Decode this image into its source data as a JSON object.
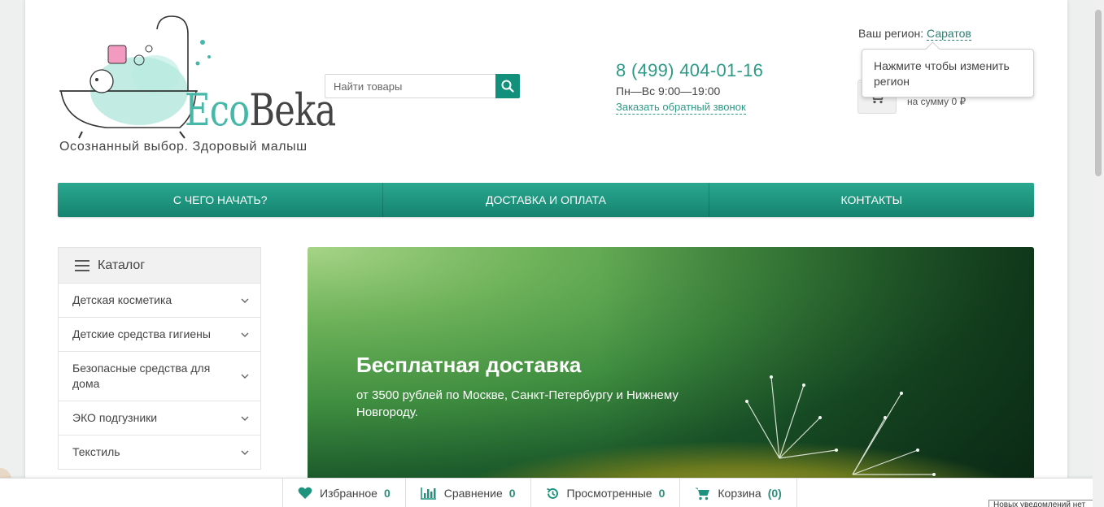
{
  "header": {
    "logo_text_a": "Eco",
    "logo_text_b": "Beka",
    "tagline": "Осознанный выбор. Здоровый малыш",
    "search_placeholder": "Найти товары",
    "phone": "8 (499) 404-01-16",
    "hours": "Пн—Вс 9:00—19:00",
    "callback": "Заказать обратный звонок",
    "region_label": "Ваш регион:",
    "region_city": "Саратов",
    "region_tooltip": "Нажмите чтобы изменить регион",
    "cart_sum": "на сумму 0 ₽"
  },
  "nav": {
    "items": [
      {
        "label": "С чего начать?"
      },
      {
        "label": "Доставка и оплата"
      },
      {
        "label": "Контакты"
      }
    ]
  },
  "catalog": {
    "title": "Каталог",
    "items": [
      {
        "label": "Детская косметика"
      },
      {
        "label": "Детские средства гигиены"
      },
      {
        "label": "Безопасные средства для дома"
      },
      {
        "label": "ЭКО подгузники"
      },
      {
        "label": "Текстиль"
      }
    ]
  },
  "banner": {
    "title": "Бесплатная доставка",
    "subtitle": "от 3500 рублей по Москве, Санкт-Петербургу и Нижнему Новгороду."
  },
  "bottombar": {
    "items": [
      {
        "label": "Избранное",
        "count": "0",
        "icon": "heart-icon"
      },
      {
        "label": "Сравнение",
        "count": "0",
        "icon": "bar-chart-icon"
      },
      {
        "label": "Просмотренные",
        "count": "0",
        "icon": "history-icon"
      },
      {
        "label": "Корзина",
        "count": "(0)",
        "icon": "cart-icon"
      }
    ],
    "notice": "Новых уведомлений нет"
  },
  "colors": {
    "accent": "#15836f",
    "link": "#2c9a86"
  }
}
